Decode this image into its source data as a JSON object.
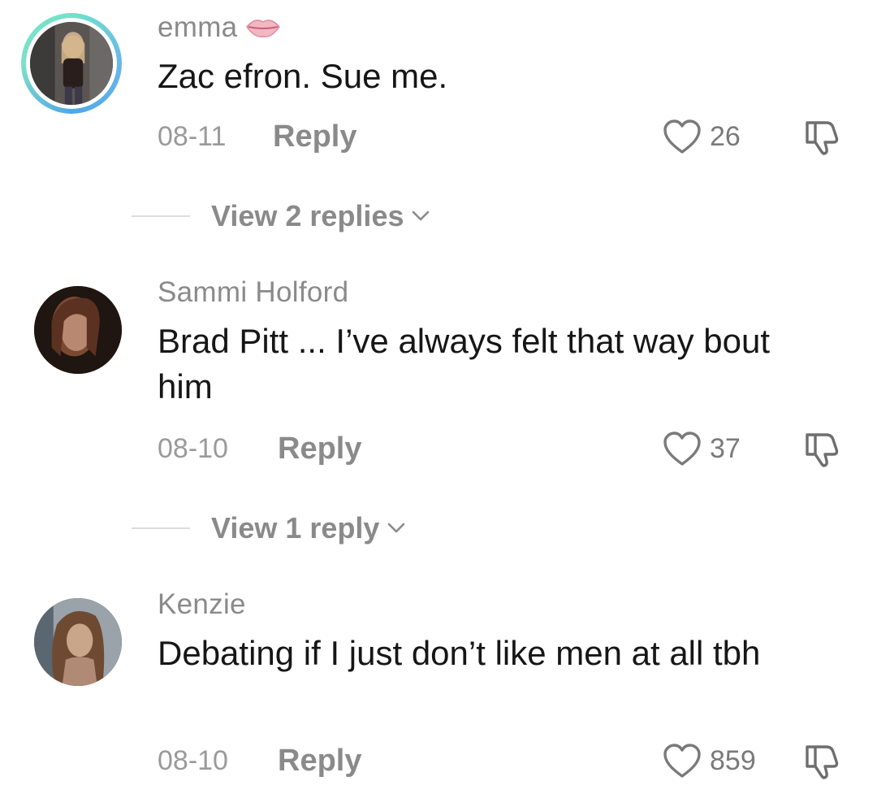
{
  "comments": [
    {
      "username": "emma",
      "username_emoji": "lips-icon",
      "text": "Zac efron. Sue me.",
      "date": "08-11",
      "reply_label": "Reply",
      "likes": "26",
      "view_replies": "View 2 replies"
    },
    {
      "username": "Sammi Holford",
      "text": "Brad Pitt ... I’ve always felt that way bout him",
      "date": "08-10",
      "reply_label": "Reply",
      "likes": "37",
      "view_replies": "View 1 reply"
    },
    {
      "username": "Kenzie",
      "text": "Debating if I just don’t like men at all tbh",
      "date": "08-10",
      "reply_label": "Reply",
      "likes": "859"
    }
  ],
  "colors": {
    "username": "#8a8a8a",
    "text": "#161616",
    "meta": "#9a9a9a",
    "story_ring": "#6ab6ea"
  },
  "icons": {
    "like": "heart-outline-icon",
    "dislike": "thumbs-down-icon",
    "expand": "chevron-down-icon"
  }
}
